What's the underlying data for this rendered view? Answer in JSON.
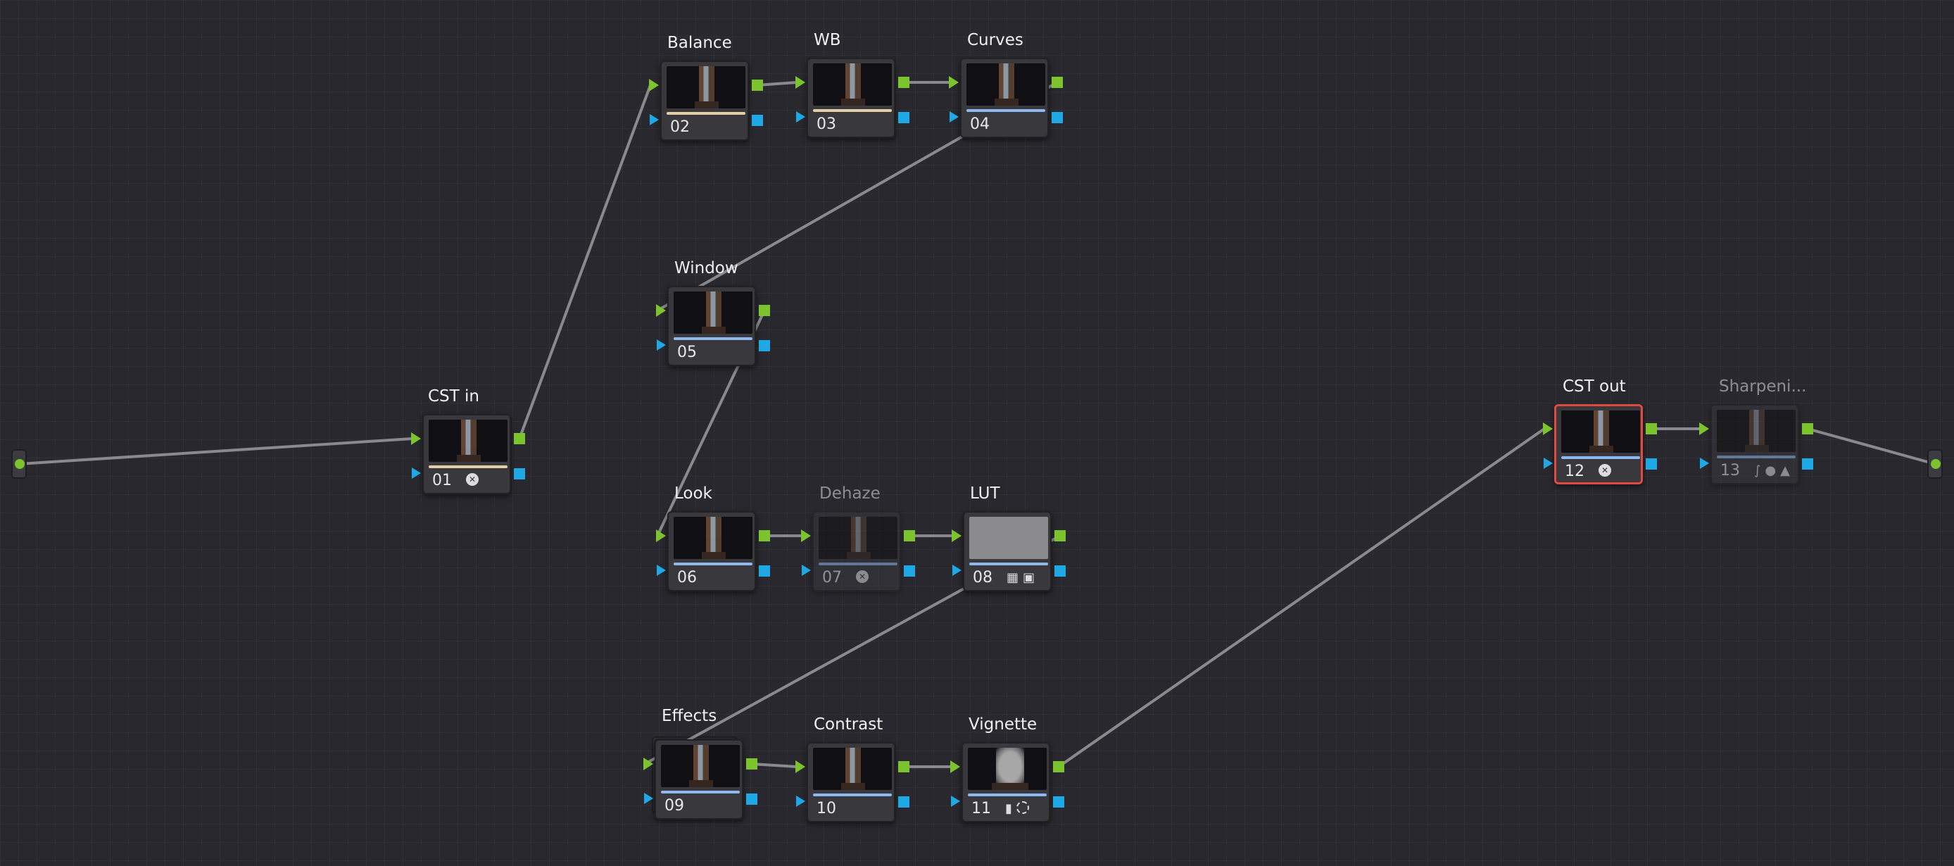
{
  "app": "Node Editor",
  "colors": {
    "background": "#28282e",
    "rgb_port": "#7bc42d",
    "key_port": "#1fa8e6",
    "wire": "#8a8a8e",
    "selected_border": "#e14a3e"
  },
  "nodes": [
    {
      "id": "n01",
      "label": "CST in",
      "number": "01",
      "bar": "#e2cfa8",
      "badges": [
        "effect-icon"
      ],
      "disabled": false
    },
    {
      "id": "n02",
      "label": "Balance",
      "number": "02",
      "bar": "#e2cfa8",
      "badges": [],
      "disabled": false
    },
    {
      "id": "n03",
      "label": "WB",
      "number": "03",
      "bar": "#e2cfa8",
      "badges": [],
      "disabled": false
    },
    {
      "id": "n04",
      "label": "Curves",
      "number": "04",
      "bar": "#8fb8f0",
      "badges": [],
      "disabled": false
    },
    {
      "id": "n05",
      "label": "Window",
      "number": "05",
      "bar": "#8fb8f0",
      "badges": [],
      "disabled": false
    },
    {
      "id": "n06",
      "label": "Look",
      "number": "06",
      "bar": "#8fb8f0",
      "badges": [],
      "disabled": false
    },
    {
      "id": "n07",
      "label": "Dehaze",
      "number": "07",
      "bar": "#8fb8f0",
      "badges": [
        "effect-icon"
      ],
      "disabled": true
    },
    {
      "id": "n08",
      "label": "LUT",
      "number": "08",
      "bar": "#8fb8f0",
      "badges": [
        "grid-icon",
        "lut-icon"
      ],
      "disabled": false
    },
    {
      "id": "n09",
      "label": "Effects",
      "number": "09",
      "bar": "#8fb8f0",
      "badges": [],
      "disabled": false
    },
    {
      "id": "n10",
      "label": "Contrast",
      "number": "10",
      "bar": "#8fb8f0",
      "badges": [],
      "disabled": false
    },
    {
      "id": "n11",
      "label": "Vignette",
      "number": "11",
      "bar": "#8fb8f0",
      "badges": [
        "bars-icon",
        "window-circle-icon"
      ],
      "disabled": false
    },
    {
      "id": "n12",
      "label": "CST out",
      "number": "12",
      "bar": "#8fb8f0",
      "badges": [
        "effect-icon"
      ],
      "disabled": false,
      "selected": true
    },
    {
      "id": "n13",
      "label": "Sharpeni...",
      "number": "13",
      "bar": "#8fb8f0",
      "badges": [
        "curve-icon",
        "drop-icon",
        "triangle-icon"
      ],
      "disabled": true
    }
  ],
  "connections": [
    [
      "source",
      "n01"
    ],
    [
      "n01",
      "n02"
    ],
    [
      "n02",
      "n03"
    ],
    [
      "n03",
      "n04"
    ],
    [
      "n04",
      "n05"
    ],
    [
      "n05",
      "n06"
    ],
    [
      "n06",
      "n07"
    ],
    [
      "n07",
      "n08"
    ],
    [
      "n08",
      "n09"
    ],
    [
      "n09",
      "n10"
    ],
    [
      "n10",
      "n11"
    ],
    [
      "n11",
      "n12"
    ],
    [
      "n12",
      "n13"
    ],
    [
      "n13",
      "output"
    ]
  ]
}
